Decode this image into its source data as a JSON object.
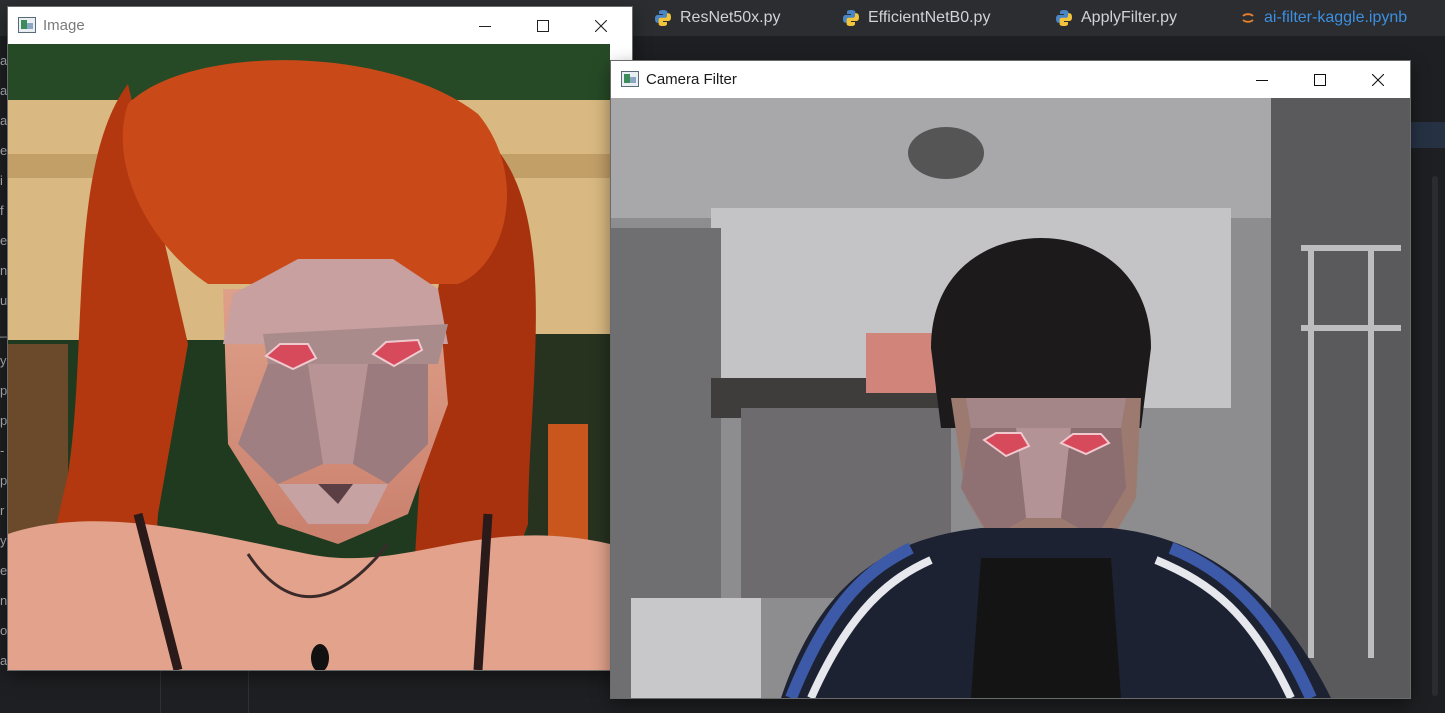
{
  "ide": {
    "tabs": [
      {
        "label": "ResNet50x.py",
        "icon": "python-file-icon",
        "active": false
      },
      {
        "label": "EfficientNetB0.py",
        "icon": "python-file-icon",
        "active": false
      },
      {
        "label": "ApplyFilter.py",
        "icon": "python-file-icon",
        "active": false
      },
      {
        "label": "ai-filter-kaggle.ipynb",
        "icon": "jupyter-notebook-icon",
        "active": true
      }
    ],
    "left_strip_chars": [
      "a",
      "a",
      "a",
      "e",
      "i",
      "f",
      "e",
      "n",
      "u",
      "_",
      "y",
      "p",
      "p",
      "-",
      "p",
      "r",
      "y",
      "e",
      "n",
      "o",
      "a"
    ]
  },
  "windows": {
    "image": {
      "title": "Image",
      "icon": "opencv-window-icon",
      "content": "photo-red-haired-woman-with-polygon-face-filter"
    },
    "camera": {
      "title": "Camera Filter",
      "icon": "opencv-window-icon",
      "content": "webcam-feed-person-with-polygon-face-filter"
    }
  },
  "colors": {
    "ide_bg": "#1e1f22",
    "tab_bar": "#2b2d30",
    "active_tab_text": "#3d8fe0",
    "window_title_bg": "#ffffff"
  }
}
